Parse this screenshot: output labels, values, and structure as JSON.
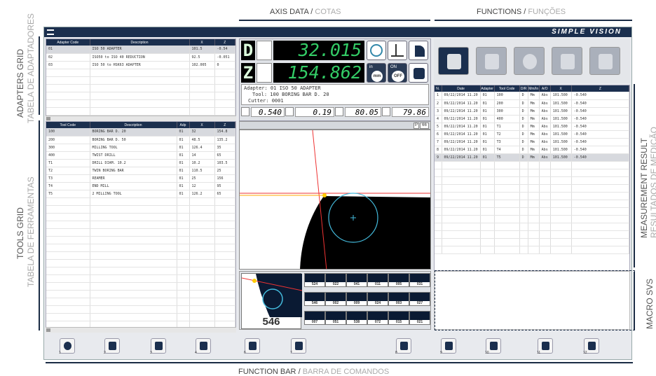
{
  "annotations": {
    "axis_data": "AXIS DATA",
    "axis_data_pt": "COTAS",
    "functions": "FUNCTIONS",
    "functions_pt": "FUNÇÕES",
    "adapters_grid": "ADAPTERS GRID",
    "adapters_grid_pt": "TABELA DE ADAPTADORES",
    "tools_grid": "TOOLS GRID",
    "tools_grid_pt": "TABELA DE FERRAMENTAS",
    "measurement_result": "MEASUREMENT RESULT",
    "measurement_result_pt": "RESULTADOS DE MEDIÇÃO",
    "macro_svs": "MACRO SVS",
    "function_bar": "FUNCTION BAR",
    "function_bar_pt": "BARRA DE COMANDOS",
    "sep": "/"
  },
  "app": {
    "logo": "SIMPLE VISION"
  },
  "adapters": {
    "columns": [
      "Adapter Code",
      "Description",
      "X",
      "Z"
    ],
    "rows": [
      [
        "01",
        "ISO 50 ADAPTER",
        "101.5",
        "-0.54"
      ],
      [
        "02",
        "ISO50 to ISO 40 REDUCTION",
        "92.5",
        "-0.051"
      ],
      [
        "03",
        "ISO 50 to HSK63 ADAPTER",
        "102.005",
        "0"
      ]
    ]
  },
  "tools": {
    "columns": [
      "Tool Code",
      "Description",
      "Adp",
      "X",
      "Z"
    ],
    "rows": [
      [
        "100",
        "BORING BAR D. 20",
        "01",
        "32",
        "154.8"
      ],
      [
        "200",
        "BORING BAR D. 50",
        "01",
        "48.5",
        "135.2"
      ],
      [
        "300",
        "MILLING TOOL",
        "01",
        "126.4",
        "35"
      ],
      [
        "400",
        "TWIST DRILL",
        "01",
        "14",
        "65"
      ],
      [
        "T1",
        "DRILL DIAM. 10.2",
        "01",
        "10.2",
        "103.5"
      ],
      [
        "T2",
        "TWIN BORING BAR",
        "01",
        "110.5",
        "25"
      ],
      [
        "T3",
        "REAMER",
        "01",
        "25",
        "156"
      ],
      [
        "T4",
        "END MILL",
        "01",
        "12",
        "95"
      ],
      [
        "T5",
        "2 MILLING TOOL",
        "01",
        "126.2",
        "65"
      ]
    ]
  },
  "axis": {
    "x_letter": "D",
    "z_letter": "Z",
    "x_value": "32.015",
    "z_value": "154.862",
    "btn_mm": "mm",
    "btn_on": "ON",
    "btn_off": "OFF",
    "btn_in": "in",
    "adapter_line": "Adapter: 01    ISO 50 ADAPTER",
    "tool_line": "Tool: 100   BORING BAR D. 20",
    "cutter_line": "Cutter: 0001",
    "small_values": [
      "0.540",
      "0.19",
      "80.05",
      "79.86"
    ],
    "p_label": "P",
    "zoom": "66"
  },
  "macro_main_label": "546",
  "macro_tiles": [
    "524",
    "022",
    "041",
    "011",
    "005",
    "031",
    "546",
    "002",
    "009",
    "024",
    "003",
    "027",
    "007",
    "051",
    "538",
    "072",
    "015",
    "021"
  ],
  "results": {
    "columns": [
      "N.",
      "Date",
      "Adapter",
      "Tool Code",
      "D/R",
      "Mm/In",
      "A/O",
      "X",
      "Z"
    ],
    "rows": [
      [
        "1",
        "09/22/2014 11.20",
        "01",
        "100",
        "D",
        "Mm",
        "Abs",
        "101.500",
        "-0.540"
      ],
      [
        "2",
        "09/22/2014 11.20",
        "01",
        "200",
        "D",
        "Mm",
        "Abs",
        "101.500",
        "-0.540"
      ],
      [
        "3",
        "09/22/2014 11.20",
        "01",
        "300",
        "D",
        "Mm",
        "Abs",
        "101.500",
        "-0.540"
      ],
      [
        "4",
        "09/22/2014 11.20",
        "01",
        "400",
        "D",
        "Mm",
        "Abs",
        "101.500",
        "-0.540"
      ],
      [
        "5",
        "09/22/2014 11.20",
        "01",
        "T1",
        "D",
        "Mm",
        "Abs",
        "101.500",
        "-0.540"
      ],
      [
        "6",
        "09/22/2014 11.20",
        "01",
        "T2",
        "D",
        "Mm",
        "Abs",
        "101.500",
        "-0.540"
      ],
      [
        "7",
        "09/22/2014 11.20",
        "01",
        "T3",
        "D",
        "Mm",
        "Abs",
        "101.500",
        "-0.540"
      ],
      [
        "8",
        "09/22/2014 11.20",
        "01",
        "T4",
        "D",
        "Mm",
        "Abs",
        "101.500",
        "-0.540"
      ],
      [
        "9",
        "09/22/2014 11.20",
        "01",
        "T5",
        "D",
        "Mm",
        "Abs",
        "101.500",
        "-0.540"
      ]
    ]
  },
  "functions": [
    "caliper-icon",
    "machine-icon",
    "gauge-icon",
    "tool-holder-icon",
    "clear-icon"
  ],
  "function_bar": [
    {
      "icon": "help-icon",
      "n": "1"
    },
    {
      "icon": "print-icon",
      "n": "2"
    },
    {
      "icon": "open-icon",
      "n": "3"
    },
    {
      "icon": "camera-icon",
      "n": "4"
    },
    {
      "icon": "eraser-icon",
      "n": "6"
    },
    {
      "icon": "light-icon",
      "n": "7"
    },
    {
      "icon": "db-save-icon",
      "n": "8"
    },
    {
      "icon": "db-settings-icon",
      "n": "9"
    },
    {
      "icon": "report-icon",
      "n": "10"
    },
    {
      "icon": "fullscreen-icon",
      "n": "11"
    },
    {
      "icon": "settings-icon",
      "n": "12"
    }
  ]
}
